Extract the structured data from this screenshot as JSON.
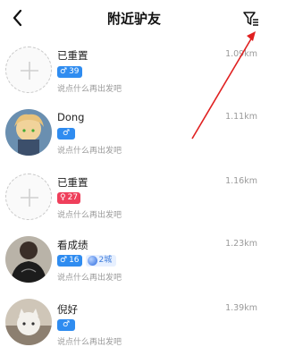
{
  "header": {
    "title": "附近驴友",
    "back_icon": "back-chevron-icon",
    "filter_icon": "filter-icon"
  },
  "users": [
    {
      "name": "已重置",
      "distance": "1.09km",
      "gender": "♂",
      "gender_color": "#2f8cf0",
      "age": "39",
      "subtitle": "说点什么再出发吧",
      "avatar": "placeholder"
    },
    {
      "name": "Dong",
      "distance": "1.11km",
      "gender": "♂",
      "gender_color": "#2f8cf0",
      "age": "",
      "subtitle": "说点什么再出发吧",
      "avatar": "anime"
    },
    {
      "name": "已重置",
      "distance": "1.16km",
      "gender": "♀",
      "gender_color": "#ef3f5b",
      "age": "27",
      "subtitle": "说点什么再出发吧",
      "avatar": "placeholder"
    },
    {
      "name": "看成绩",
      "distance": "1.23km",
      "gender": "♂",
      "gender_color": "#2f8cf0",
      "age": "16",
      "city_badge": "2城",
      "subtitle": "说点什么再出发吧",
      "avatar": "dark-shirt"
    },
    {
      "name": "倪好",
      "distance": "1.39km",
      "gender": "♂",
      "gender_color": "#2f8cf0",
      "age": "",
      "subtitle": "说点什么再出发吧",
      "avatar": "cat"
    }
  ],
  "annotation": {
    "arrow_color": "#e02020"
  }
}
